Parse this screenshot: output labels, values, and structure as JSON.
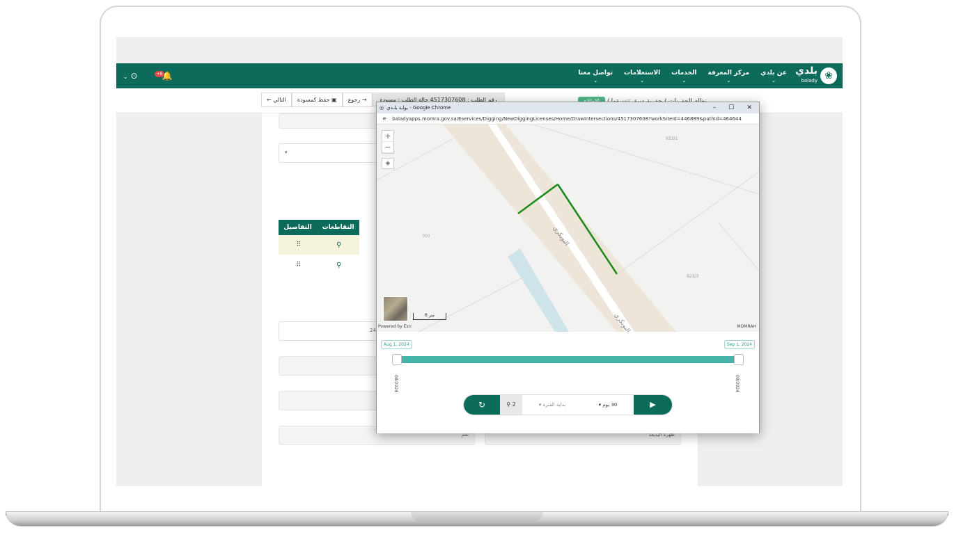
{
  "header": {
    "logo_text": "بلدي",
    "logo_sub": "balady",
    "menu": [
      "عن بلدي",
      "مركز المعرفة",
      "الخدمات",
      "الاستعلامات",
      "تواصل معنا"
    ],
    "notification_badge": "+9"
  },
  "subbar": {
    "breadcrumb_root": "نظام الحفريات",
    "breadcrumb_current": "حفرية سبق تنسيقها",
    "status_pill": "الإطلاع",
    "request_info": "رقم الطلب : 4517307608    حالة الطلب : مسودة",
    "back_label": "رجوع",
    "save_draft_label": "حفظ كمسودة",
    "next_label": "التالي"
  },
  "content": {
    "table_headers": [
      "التفاصيل",
      "التقاطعات"
    ],
    "partial_number": "24",
    "field_yes": "نعم",
    "field_label": "ظهرة البديعة"
  },
  "popup": {
    "title": "بوابة بلـدي - Google Chrome",
    "url": "baladyapps.momra.gov.sa/Eservices/Digging/NewDiggingLicenses/Home/DrawIntersections/4517307608?workSiteId=446889&pathId=464644",
    "map": {
      "parcel_1": "923/1",
      "parcel_2": "923/3",
      "parcel_3": "300",
      "street_name": "النوبكري",
      "scale_label": "6 متر",
      "powered_by": "Powered by Esri",
      "attribution": "MOMRAH"
    },
    "timeslider": {
      "start_chip": "Aug 1, 2024",
      "end_chip": "Sep 1, 2024",
      "tick_start": "08/2024",
      "tick_end": "09/2024",
      "count": "2",
      "period_start": "بداية الفترة",
      "days": "30 يوم"
    }
  },
  "colors": {
    "brand": "#0d6b5c",
    "slider": "#46b3a8",
    "row_highlight": "#f5f3dc"
  }
}
